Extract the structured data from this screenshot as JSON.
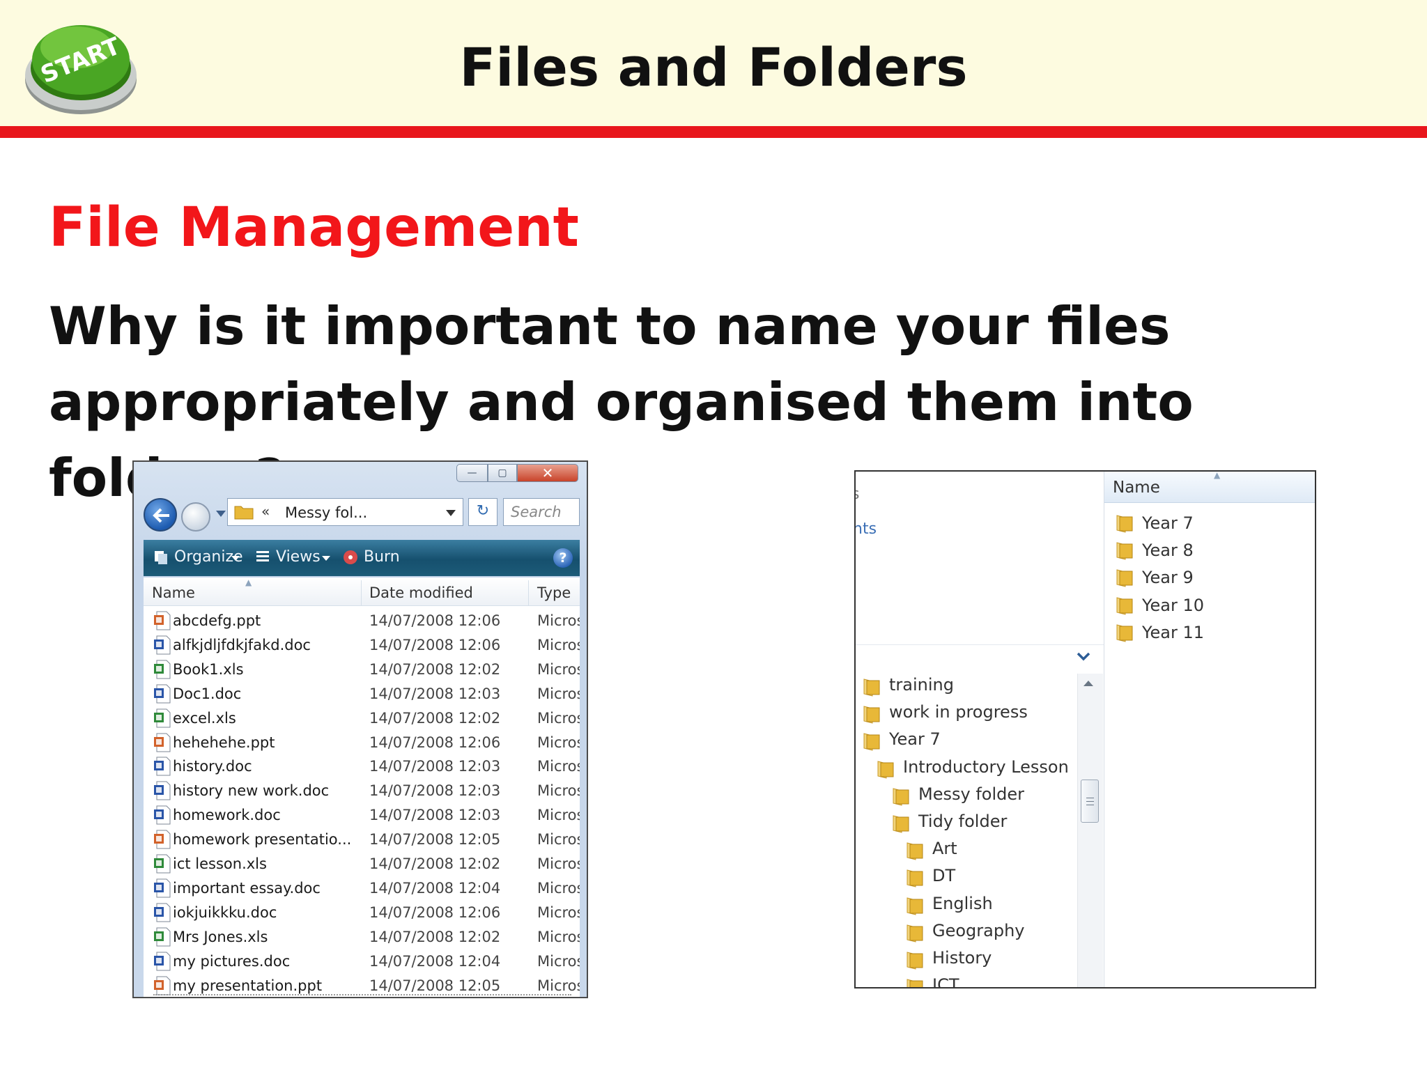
{
  "slide": {
    "title": "Files and Folders",
    "start_button_label": "START",
    "subtitle": "File Management",
    "question_line1": "Why is it important to name your files",
    "question_line2": "appropriately and organised them into folders?"
  },
  "colors": {
    "header_bg": "#fdfbe0",
    "header_rule": "#e8161c",
    "subtitle": "#f2161a",
    "start_button": "#3f9a1e"
  },
  "left_window": {
    "address": "Messy fol...",
    "address_sep": "«",
    "search_placeholder": "Search",
    "toolbar": {
      "organize": "Organize",
      "views": "Views",
      "burn": "Burn"
    },
    "columns": {
      "name": "Name",
      "date": "Date modified",
      "type": "Type"
    },
    "files": [
      {
        "name": "abcdefg.ppt",
        "date": "14/07/2008 12:06",
        "type": "Micros",
        "kind": "ppt"
      },
      {
        "name": "alfkjdljfdkjfakd.doc",
        "date": "14/07/2008 12:06",
        "type": "Micros",
        "kind": "doc"
      },
      {
        "name": "Book1.xls",
        "date": "14/07/2008 12:02",
        "type": "Micros",
        "kind": "xls"
      },
      {
        "name": "Doc1.doc",
        "date": "14/07/2008 12:03",
        "type": "Micros",
        "kind": "doc"
      },
      {
        "name": "excel.xls",
        "date": "14/07/2008 12:02",
        "type": "Micros",
        "kind": "xls"
      },
      {
        "name": "hehehehe.ppt",
        "date": "14/07/2008 12:06",
        "type": "Micros",
        "kind": "ppt"
      },
      {
        "name": "history.doc",
        "date": "14/07/2008 12:03",
        "type": "Micros",
        "kind": "doc"
      },
      {
        "name": "history new work.doc",
        "date": "14/07/2008 12:03",
        "type": "Micros",
        "kind": "doc"
      },
      {
        "name": "homework.doc",
        "date": "14/07/2008 12:03",
        "type": "Micros",
        "kind": "doc"
      },
      {
        "name": "homework presentatio...",
        "date": "14/07/2008 12:05",
        "type": "Micros",
        "kind": "ppt"
      },
      {
        "name": "ict lesson.xls",
        "date": "14/07/2008 12:02",
        "type": "Micros",
        "kind": "xls"
      },
      {
        "name": "important essay.doc",
        "date": "14/07/2008 12:04",
        "type": "Micros",
        "kind": "doc"
      },
      {
        "name": "iokjuikkku.doc",
        "date": "14/07/2008 12:06",
        "type": "Micros",
        "kind": "doc"
      },
      {
        "name": "Mrs Jones.xls",
        "date": "14/07/2008 12:02",
        "type": "Micros",
        "kind": "xls"
      },
      {
        "name": "my pictures.doc",
        "date": "14/07/2008 12:04",
        "type": "Micros",
        "kind": "doc"
      },
      {
        "name": "my presentation.ppt",
        "date": "14/07/2008 12:05",
        "type": "Micros",
        "kind": "ppt"
      }
    ]
  },
  "right_window": {
    "nav_fragment_1": "s",
    "nav_fragment_2": "nts",
    "tree": [
      {
        "label": "training",
        "level": 0
      },
      {
        "label": "work in progress",
        "level": 0
      },
      {
        "label": "Year 7",
        "level": 0
      },
      {
        "label": "Introductory Lesson",
        "level": 1
      },
      {
        "label": "Messy folder",
        "level": 2
      },
      {
        "label": "Tidy folder",
        "level": 2
      },
      {
        "label": "Art",
        "level": 3
      },
      {
        "label": "DT",
        "level": 3
      },
      {
        "label": "English",
        "level": 3
      },
      {
        "label": "Geography",
        "level": 3
      },
      {
        "label": "History",
        "level": 3
      },
      {
        "label": "ICT",
        "level": 3
      }
    ],
    "content_header": "Name",
    "content_items": [
      "Year 7",
      "Year 8",
      "Year 9",
      "Year 10",
      "Year 11"
    ]
  }
}
